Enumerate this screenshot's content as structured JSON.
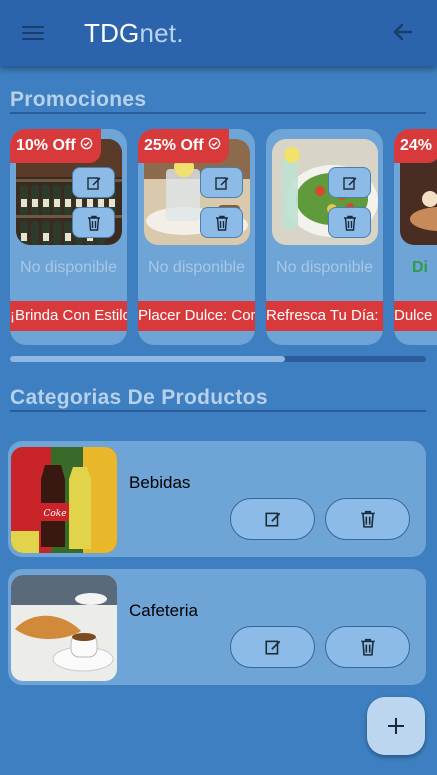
{
  "header": {
    "brand_part1": "TDG",
    "brand_part2": "net."
  },
  "promotions": {
    "title": "Promociones",
    "items": [
      {
        "badge": "10% Off",
        "status": "No disponible",
        "name": "¡Brinda Con Estilo!"
      },
      {
        "badge": "25% Off",
        "status": "No disponible",
        "name": "Placer Dulce: Combo"
      },
      {
        "badge": "",
        "status": "No disponible",
        "name": "Refresca Tu Día: Combo"
      },
      {
        "badge": "24%",
        "status": "Di",
        "name": "Dulce"
      }
    ],
    "scroll_progress": 0.66
  },
  "categories": {
    "title": "Categorias De Productos",
    "items": [
      {
        "name": "Bebidas"
      },
      {
        "name": "Cafeteria"
      }
    ]
  },
  "colors": {
    "background": "#3d7fc0",
    "header": "#2b64ad",
    "accent_red": "#d8393b",
    "card": "#6ea4d6",
    "available_green": "#2e9c4a"
  },
  "icons": [
    "menu-icon",
    "arrow-back-icon",
    "verified-badge-icon",
    "edit-icon",
    "trash-icon",
    "plus-icon"
  ]
}
